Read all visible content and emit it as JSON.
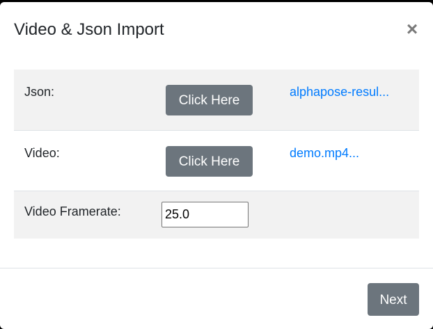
{
  "dialog": {
    "title": "Video & Json Import",
    "close_glyph": "×"
  },
  "rows": [
    {
      "label": "Json:",
      "button_label": "Click Here",
      "file_name": "alphapose-resul..."
    },
    {
      "label": "Video:",
      "button_label": "Click Here",
      "file_name": "demo.mp4..."
    },
    {
      "label": "Video Framerate:",
      "input_value": "25.0"
    }
  ],
  "footer": {
    "next_label": "Next"
  },
  "colors": {
    "button_bg": "#6c757d",
    "link": "#007bff",
    "stripe": "#f2f2f2",
    "backdrop": "#000000"
  }
}
